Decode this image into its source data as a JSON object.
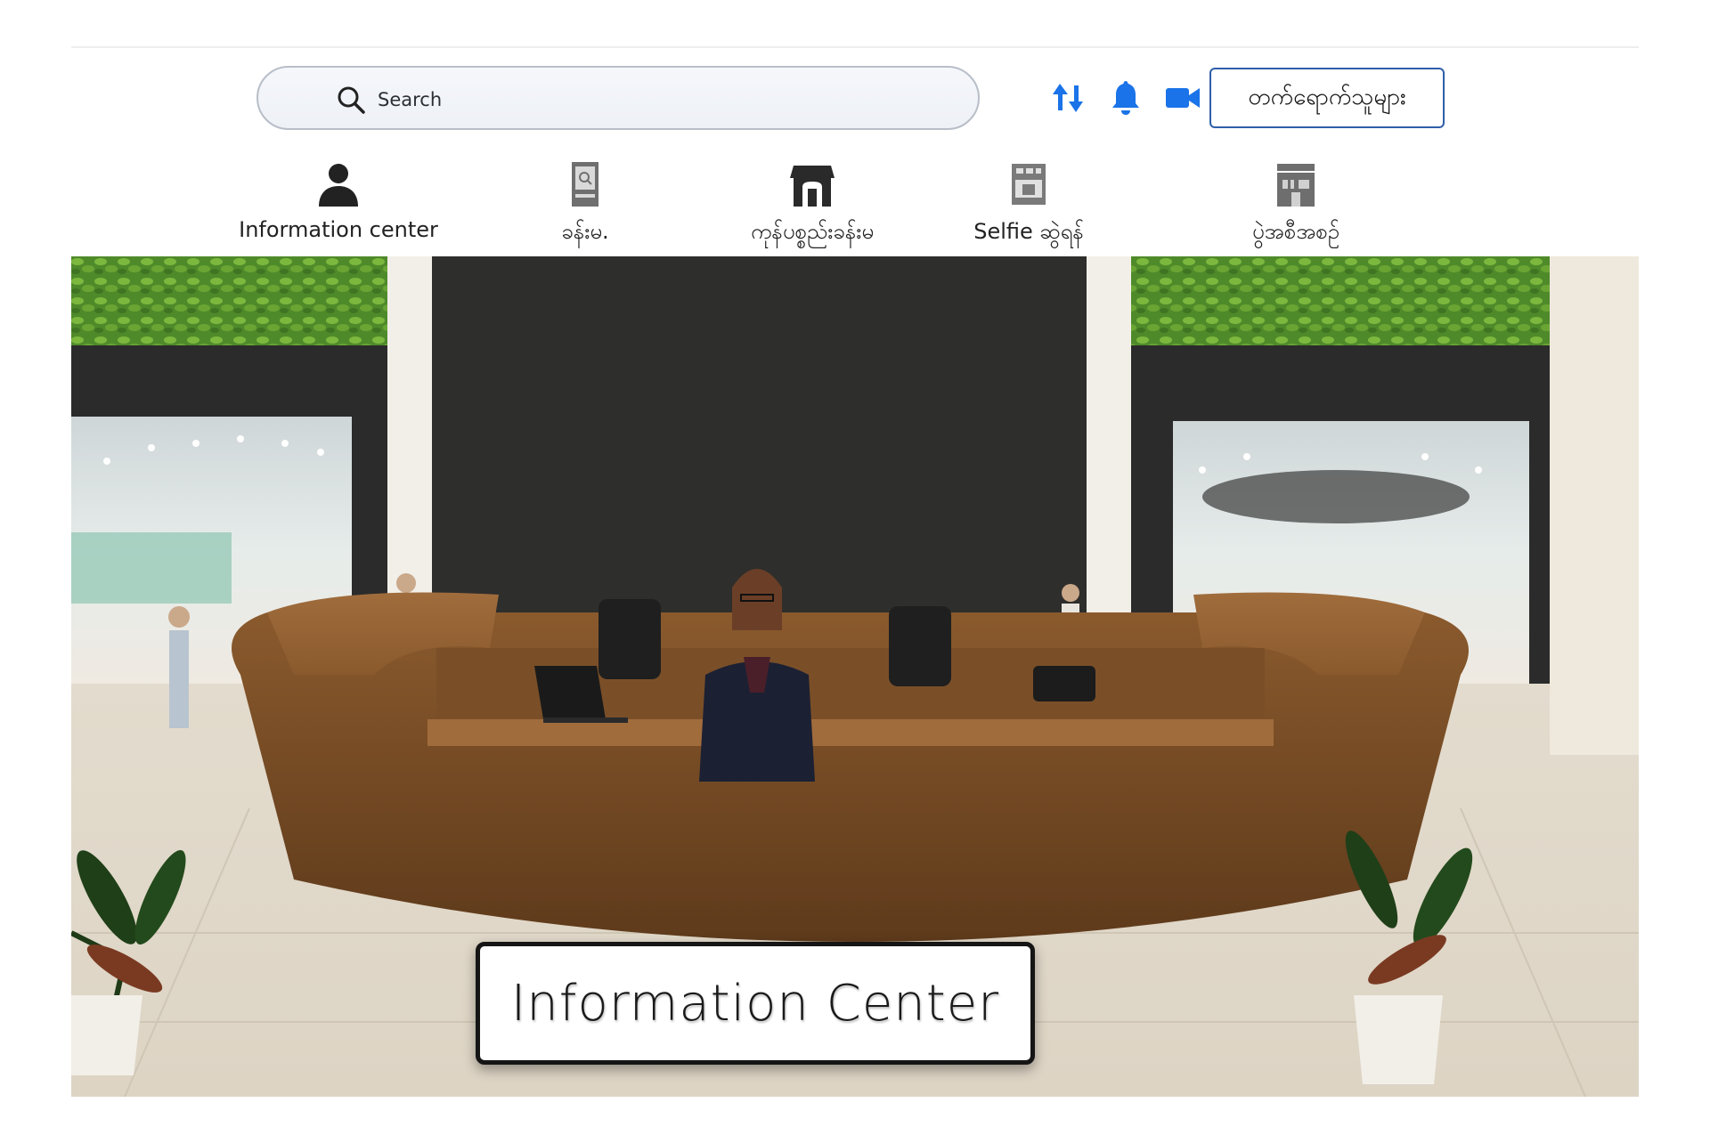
{
  "search": {
    "placeholder": "Search"
  },
  "toolbar": {
    "icons": [
      "swap-arrows-icon",
      "bell-icon",
      "video-camera-icon"
    ],
    "accent_color": "#1a73e8",
    "follow_button_label": "တက်ရောက်သူများ"
  },
  "nav": {
    "items": [
      {
        "label": "Information center",
        "icon": "person-icon"
      },
      {
        "label": "ခန်းမ.",
        "icon": "hall-icon"
      },
      {
        "label": "ကုန်ပစ္စည်းခန်းမ",
        "icon": "storefront-icon"
      },
      {
        "label": "Selfie ဆွဲရန်",
        "icon": "selfie-booth-icon"
      },
      {
        "label": "ပွဲအစီအစဉ်",
        "icon": "event-building-icon"
      }
    ]
  },
  "scene": {
    "sign_text": "Information Center"
  }
}
